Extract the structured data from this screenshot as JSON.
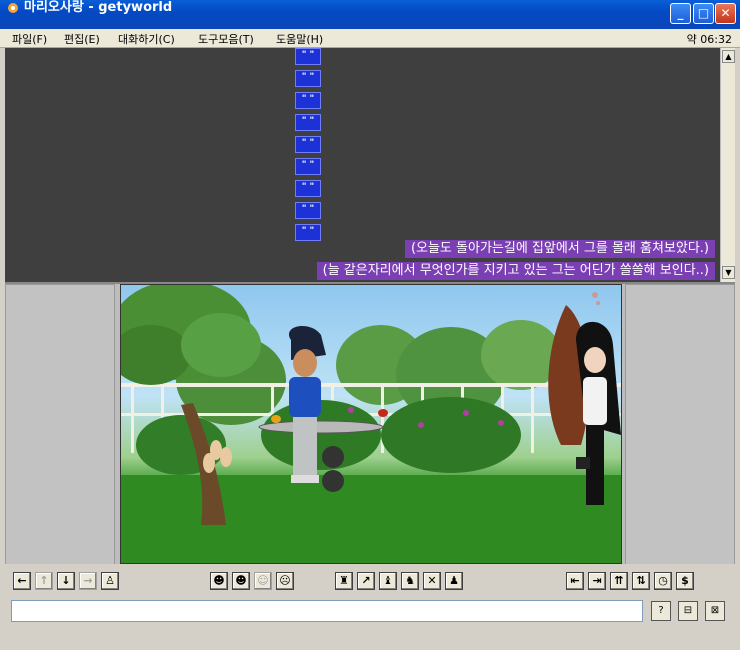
{
  "window": {
    "title": "마리오사랑 - getyworld",
    "minimize": "_",
    "maximize": "□",
    "close": "✕"
  },
  "menu": {
    "items": [
      "파일(F)",
      "편집(E)",
      "대화하기(C)",
      "도구모음(T)",
      "도움말(H)"
    ],
    "clock": "약 06:32"
  },
  "chat": {
    "quote_glyph": "\" \"",
    "quote_count": 9,
    "lines": [
      "(오늘도 돌아가는길에 집앞에서 그를 몰래 훔쳐보았다.)",
      "(늘 같은자리에서 무엇인가를 지키고 있는 그는 어딘가 쓸쓸해 보인다..)"
    ]
  },
  "toolbar": {
    "nav": [
      "←",
      "↑",
      "↓",
      "→",
      "♙"
    ],
    "faces": [
      "☻",
      "☻",
      "☺",
      "☹"
    ],
    "actions": [
      "♜",
      "↗",
      "♝",
      "♞",
      "✕",
      "♟"
    ],
    "right": [
      "⇤",
      "⇥",
      "⇈",
      "⇅",
      "◷",
      "$"
    ]
  },
  "input": {
    "value": "",
    "buttons": [
      "?",
      "⊟",
      "⊠"
    ]
  },
  "colors": {
    "chat_bg": "#3f3f3f",
    "thought_bg": "#7a3fb2",
    "quote_bg": "#1c32d6"
  }
}
